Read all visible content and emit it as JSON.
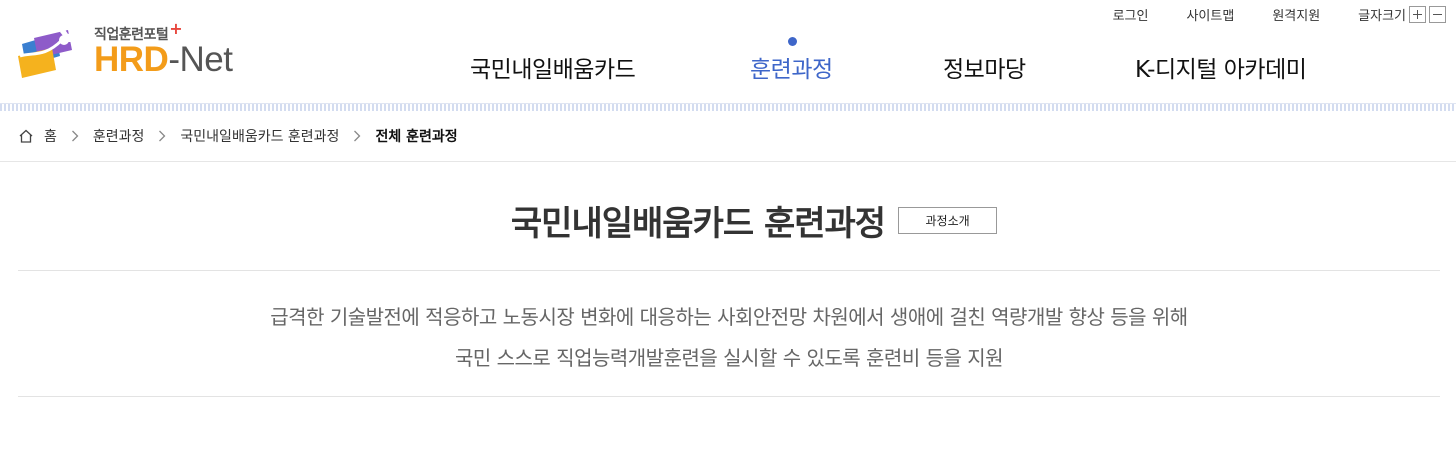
{
  "utility_links": {
    "login": "로그인",
    "sitemap": "사이트맵",
    "remote_support": "원격지원",
    "font_size": "글자크기"
  },
  "logo": {
    "subtitle": "직업훈련포털",
    "subtitle_plus": "+",
    "name_hrd": "HRD",
    "name_dash": "-",
    "name_net": "Net"
  },
  "gnb": {
    "items": [
      "국민내일배움카드",
      "훈련과정",
      "정보마당",
      "K-디지털 아카데미"
    ],
    "active_index": 1
  },
  "breadcrumb": {
    "items": [
      "홈",
      "훈련과정",
      "국민내일배움카드 훈련과정",
      "전체 훈련과정"
    ]
  },
  "page": {
    "title": "국민내일배움카드 훈련과정",
    "intro_button": "과정소개",
    "description_line1": "급격한 기술발전에 적응하고 노동시장 변화에 대응하는 사회안전망 차원에서 생애에 걸친 역량개발 향상 등을 위해",
    "description_line2": "국민 스스로 직업능력개발훈련을 실시할 수 있도록 훈련비 등을 지원"
  },
  "colors": {
    "accent": "#3e66c9",
    "logo_orange": "#f39c1a",
    "logo_plus": "#e8463d"
  }
}
